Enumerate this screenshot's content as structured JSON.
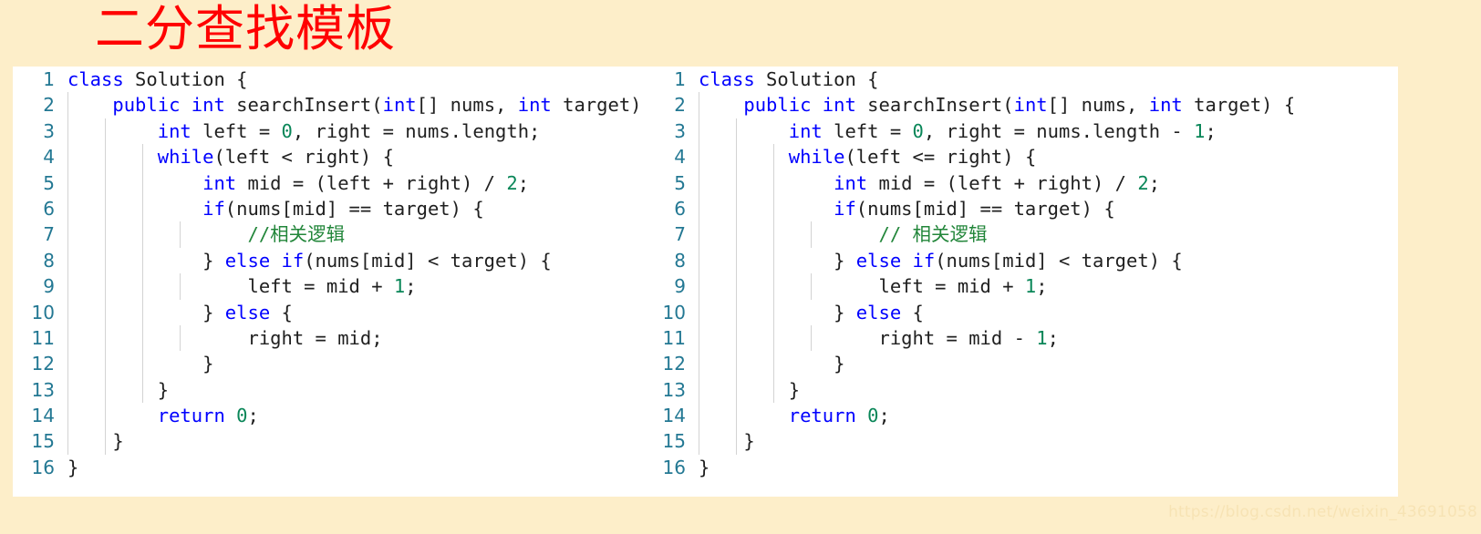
{
  "title": "二分查找模板",
  "watermark": "https://blog.csdn.net/weixin_43691058",
  "colors": {
    "background": "#fdeec9",
    "panel": "#ffffff",
    "title": "#ff0000",
    "keyword": "#0000ff",
    "number": "#098658",
    "comment": "#22863a",
    "line_number": "#237893",
    "indent_guide": "#d3d3d3",
    "watermark": "#f7e3b4"
  },
  "panels": [
    {
      "name": "left-code-panel",
      "language": "java",
      "line_numbers": [
        "1",
        "2",
        "3",
        "4",
        "5",
        "6",
        "7",
        "8",
        "9",
        "10",
        "11",
        "12",
        "13",
        "14",
        "15",
        "16"
      ],
      "lines": [
        "class Solution {",
        "    public int searchInsert(int[] nums, int target) {",
        "        int left = 0, right = nums.length;",
        "        while(left < right) {",
        "            int mid = (left + right) / 2;",
        "            if(nums[mid] == target) {",
        "                //相关逻辑",
        "            } else if(nums[mid] < target) {",
        "                left = mid + 1;",
        "            } else {",
        "                right = mid;",
        "            }",
        "        }",
        "        return 0;",
        "    }",
        "}"
      ]
    },
    {
      "name": "right-code-panel",
      "language": "java",
      "line_numbers": [
        "1",
        "2",
        "3",
        "4",
        "5",
        "6",
        "7",
        "8",
        "9",
        "10",
        "11",
        "12",
        "13",
        "14",
        "15",
        "16"
      ],
      "lines": [
        "class Solution {",
        "    public int searchInsert(int[] nums, int target) {",
        "        int left = 0, right = nums.length - 1;",
        "        while(left <= right) {",
        "            int mid = (left + right) / 2;",
        "            if(nums[mid] == target) {",
        "                // 相关逻辑",
        "            } else if(nums[mid] < target) {",
        "                left = mid + 1;",
        "            } else {",
        "                right = mid - 1;",
        "            }",
        "        }",
        "        return 0;",
        "    }",
        "}"
      ]
    }
  ]
}
